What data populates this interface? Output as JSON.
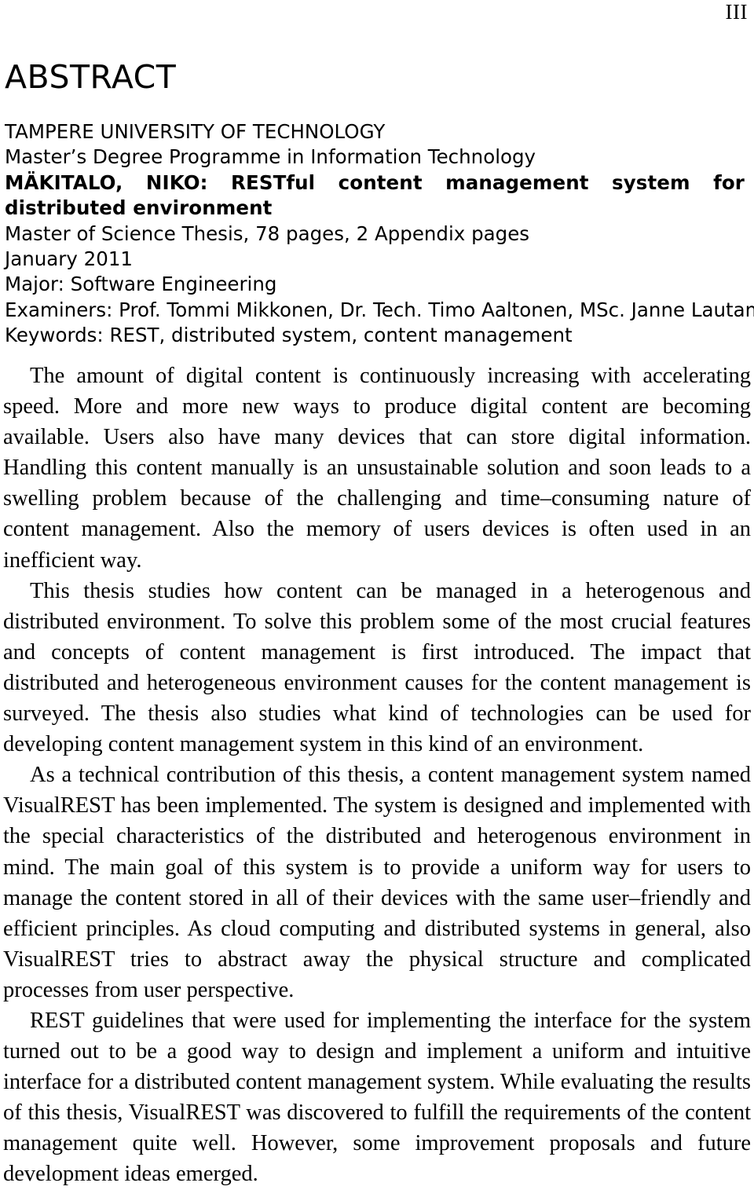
{
  "page": {
    "folio": "III",
    "heading": "ABSTRACT"
  },
  "metadata": {
    "university": "TAMPERE UNIVERSITY OF TECHNOLOGY",
    "programme": "Master’s Degree Programme in Information Technology",
    "author_title": "MÄKITALO, NIKO: RESTful content management system for distributed environment",
    "thesis_type": "Master of Science Thesis, 78 pages, 2 Appendix pages",
    "date": "January 2011",
    "major": "Major: Software Engineering",
    "examiners": "Examiners: Prof. Tommi Mikkonen, Dr. Tech. Timo Aaltonen, MSc. Janne Lautamäki",
    "keywords": "Keywords: REST, distributed system, content management"
  },
  "abstract": {
    "paragraphs": [
      "The amount of digital content is continuously increasing with accelerating speed. More and more new ways to produce digital content are becoming available. Users also have many devices that can store digital information. Handling this content manually is an unsustainable solution and soon leads to a swelling problem because of the challenging and time–consuming nature of content management. Also the memory of users devices is often used in an inefficient way.",
      "This thesis studies how content can be managed in a heterogenous and distributed environment. To solve this problem some of the most crucial features and concepts of content management is first introduced. The impact that distributed and heterogeneous environment causes for the content management is surveyed. The thesis also studies what kind of technologies can be used for developing content management system in this kind of an environment.",
      "As a technical contribution of this thesis, a content management system named VisualREST has been implemented. The system is designed and implemented with the special characteristics of the distributed and heterogenous environment in mind. The main goal of this system is to provide a uniform way for users to manage the content stored in all of their devices with the same user–friendly and efficient principles. As cloud computing and distributed systems in general, also VisualREST tries to abstract away the physical structure and complicated processes from user perspective.",
      "REST guidelines that were used for implementing the interface for the system turned out to be a good way to design and implement a uniform and intuitive interface for a distributed content management system. While evaluating the results of this thesis, VisualREST was discovered to fulfill the requirements of the content management quite well. However, some improvement proposals and future development ideas emerged."
    ]
  }
}
